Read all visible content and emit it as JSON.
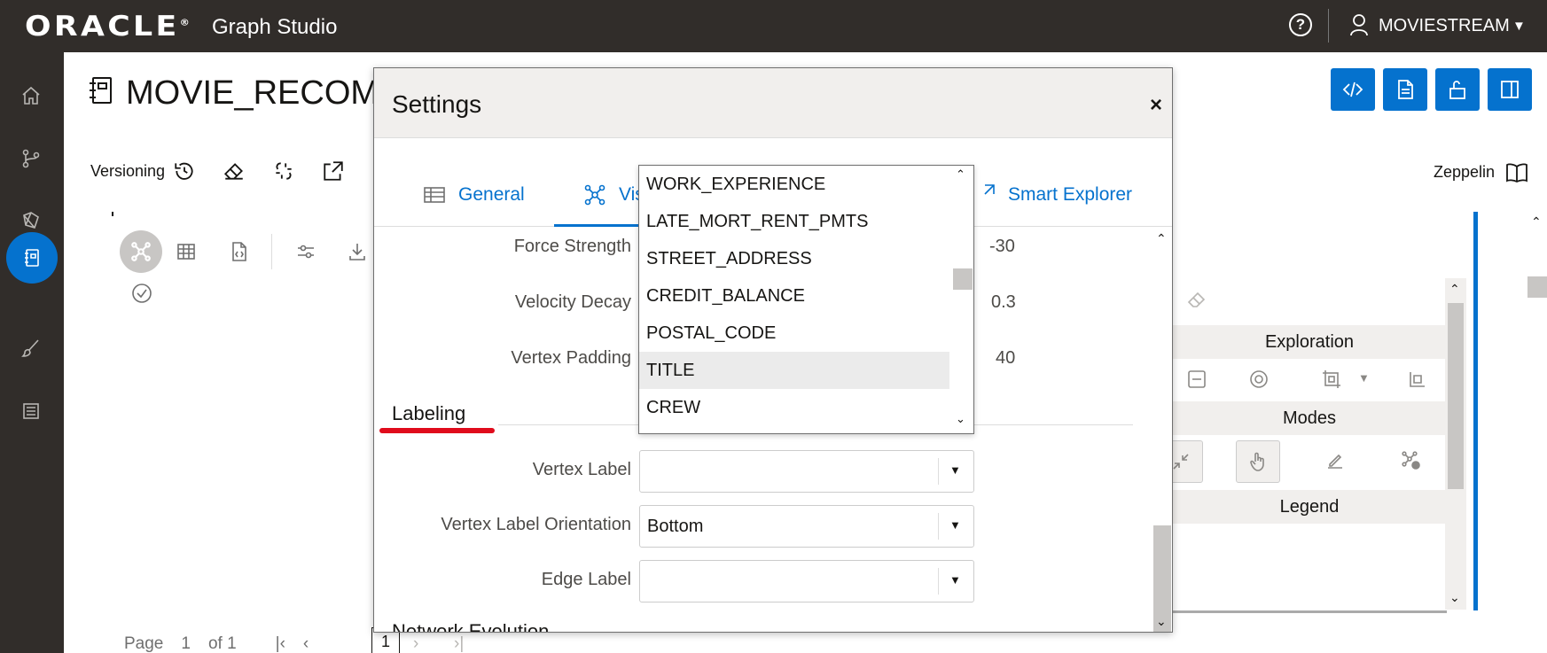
{
  "header": {
    "logo": "ORACLE",
    "logo_reg": "®",
    "product": "Graph Studio",
    "help_glyph": "?",
    "user": "MOVIESTREAM"
  },
  "notebook": {
    "title": "MOVIE_RECOMM",
    "versioning_label": "Versioning",
    "zeppelin_label": "Zeppelin"
  },
  "right_panel": {
    "exploration": "Exploration",
    "modes": "Modes",
    "legend": "Legend"
  },
  "pagination": {
    "page_label": "Page",
    "page_value": "1",
    "of_label": "of 1",
    "current_page": "1"
  },
  "settings": {
    "title": "Settings",
    "close_glyph": "×",
    "tabs": [
      {
        "label": "General"
      },
      {
        "label": "Vis"
      },
      {
        "label": "Smart Explorer"
      }
    ],
    "fields": [
      {
        "label": "Force Strength",
        "value": "-30"
      },
      {
        "label": "Velocity Decay",
        "value": "0.3"
      },
      {
        "label": "Vertex Padding",
        "value": "40"
      }
    ],
    "labeling_section": "Labeling",
    "vertex_label": {
      "label": "Vertex Label",
      "value": ""
    },
    "vertex_label_orientation": {
      "label": "Vertex Label Orientation",
      "value": "Bottom"
    },
    "edge_label": {
      "label": "Edge Label",
      "value": ""
    },
    "network_evolution_section": "Network Evolution"
  },
  "dropdown": {
    "options": [
      "WORK_EXPERIENCE",
      "LATE_MORT_RENT_PMTS",
      "STREET_ADDRESS",
      "CREDIT_BALANCE",
      "POSTAL_CODE",
      "TITLE",
      "CREW"
    ],
    "highlighted": "TITLE"
  },
  "colors": {
    "topbar": "#312d2a",
    "accent": "#0572ce",
    "annotation_red": "#e00b1c"
  },
  "icons": {
    "nav": [
      "home-icon",
      "branch-icon",
      "graph-model-icon",
      "notebook-icon",
      "brush-icon",
      "job-list-icon"
    ]
  }
}
